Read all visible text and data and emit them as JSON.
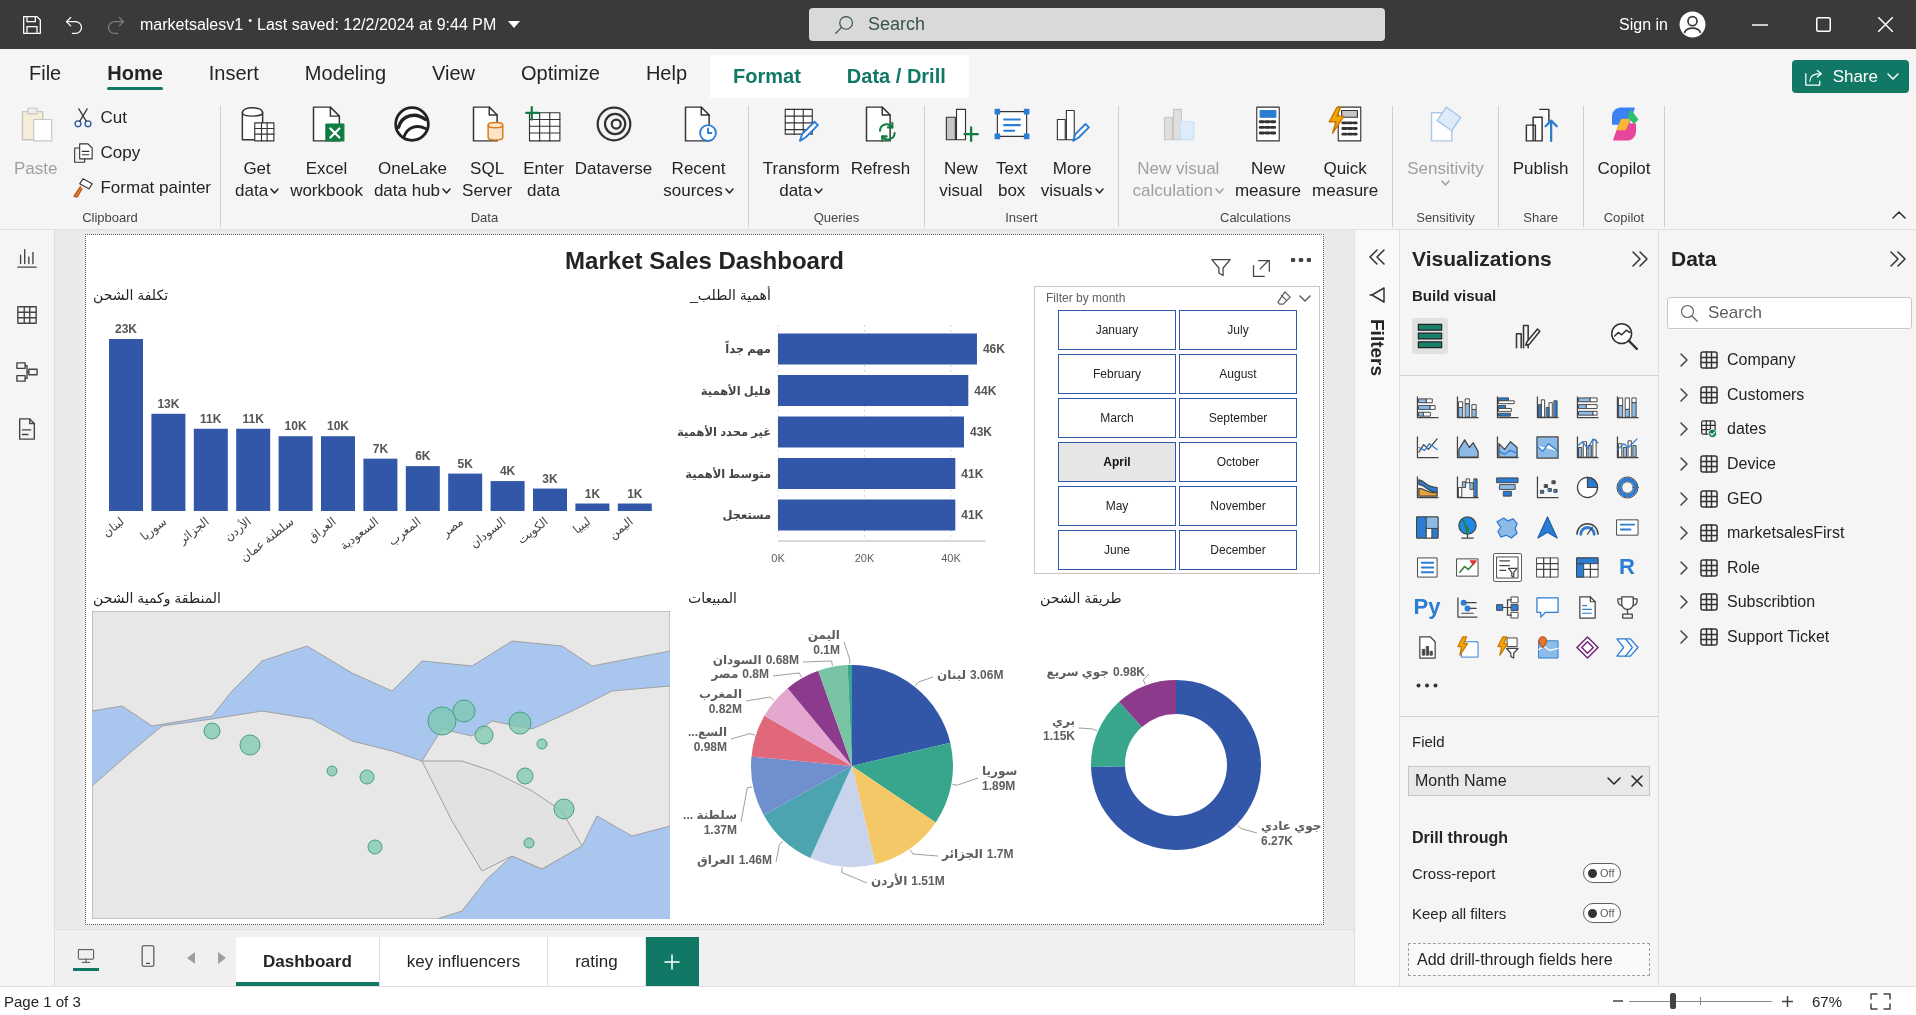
{
  "title_bar": {
    "quick_actions": [
      {
        "disabled": false
      },
      {
        "disabled": false
      },
      {
        "disabled": true
      }
    ],
    "file_name": "marketsalesv1",
    "separator": "•",
    "save_status": "Last saved: 12/2/2024 at 9:44 PM",
    "search": {
      "placeholder": "Search"
    },
    "sign_in": "Sign in"
  },
  "menu_tabs": [
    {
      "label": "File",
      "selected": false,
      "contextual": false
    },
    {
      "label": "Home",
      "selected": true,
      "contextual": false
    },
    {
      "label": "Insert",
      "selected": false,
      "contextual": false
    },
    {
      "label": "Modeling",
      "selected": false,
      "contextual": false
    },
    {
      "label": "View",
      "selected": false,
      "contextual": false
    },
    {
      "label": "Optimize",
      "selected": false,
      "contextual": false
    },
    {
      "label": "Help",
      "selected": false,
      "contextual": false
    },
    {
      "label": "Format",
      "selected": false,
      "contextual": true
    },
    {
      "label": "Data / Drill",
      "selected": false,
      "contextual": true
    }
  ],
  "share_button": {
    "label": "Share"
  },
  "ribbon": {
    "groups": [
      {
        "label": "Clipboard",
        "buttons": [
          {
            "kind": "large",
            "label_lines": [
              "Paste"
            ],
            "dropdown": false,
            "disabled": true
          },
          {
            "kind": "small",
            "label_lines": [
              "Cut"
            ],
            "dropdown": false,
            "disabled": false
          },
          {
            "kind": "small",
            "label_lines": [
              "Copy"
            ],
            "dropdown": false,
            "disabled": false
          },
          {
            "kind": "small",
            "label_lines": [
              "Format painter"
            ],
            "dropdown": false,
            "disabled": false
          }
        ]
      },
      {
        "label": "Data",
        "buttons": [
          {
            "kind": "large",
            "label_lines": [
              "Get",
              "data"
            ],
            "dropdown": true,
            "disabled": false
          },
          {
            "kind": "large",
            "label_lines": [
              "Excel",
              "workbook"
            ],
            "dropdown": false,
            "disabled": false
          },
          {
            "kind": "large",
            "label_lines": [
              "OneLake",
              "data hub"
            ],
            "dropdown": true,
            "disabled": false
          },
          {
            "kind": "large",
            "label_lines": [
              "SQL",
              "Server"
            ],
            "dropdown": false,
            "disabled": false
          },
          {
            "kind": "large",
            "label_lines": [
              "Enter",
              "data"
            ],
            "dropdown": false,
            "disabled": false
          },
          {
            "kind": "large",
            "label_lines": [
              "Dataverse"
            ],
            "dropdown": false,
            "disabled": false
          },
          {
            "kind": "large",
            "label_lines": [
              "Recent",
              "sources"
            ],
            "dropdown": true,
            "disabled": false
          }
        ]
      },
      {
        "label": "Queries",
        "buttons": [
          {
            "kind": "large",
            "label_lines": [
              "Transform",
              "data"
            ],
            "dropdown": true,
            "disabled": false
          },
          {
            "kind": "large",
            "label_lines": [
              "Refresh"
            ],
            "dropdown": false,
            "disabled": false
          }
        ]
      },
      {
        "label": "Insert",
        "buttons": [
          {
            "kind": "large",
            "label_lines": [
              "New",
              "visual"
            ],
            "dropdown": false,
            "disabled": false
          },
          {
            "kind": "large",
            "label_lines": [
              "Text",
              "box"
            ],
            "dropdown": false,
            "disabled": false
          },
          {
            "kind": "large",
            "label_lines": [
              "More",
              "visuals"
            ],
            "dropdown": true,
            "disabled": false
          }
        ]
      },
      {
        "label": "Calculations",
        "buttons": [
          {
            "kind": "large",
            "label_lines": [
              "New visual",
              "calculation"
            ],
            "dropdown": true,
            "disabled": true
          },
          {
            "kind": "large",
            "label_lines": [
              "New",
              "measure"
            ],
            "dropdown": false,
            "disabled": false
          },
          {
            "kind": "large",
            "label_lines": [
              "Quick",
              "measure"
            ],
            "dropdown": false,
            "disabled": false
          }
        ]
      },
      {
        "label": "Sensitivity",
        "buttons": [
          {
            "kind": "large",
            "label_lines": [
              "Sensitivity"
            ],
            "dropdown": true,
            "disabled": true
          }
        ]
      },
      {
        "label": "Share",
        "buttons": [
          {
            "kind": "large",
            "label_lines": [
              "Publish"
            ],
            "dropdown": false,
            "disabled": false
          }
        ]
      },
      {
        "label": "Copilot",
        "buttons": [
          {
            "kind": "large",
            "label_lines": [
              "Copilot"
            ],
            "dropdown": false,
            "disabled": false
          }
        ]
      }
    ]
  },
  "report": {
    "title": "Market Sales Dashboard",
    "shipping_cost_chart": {
      "chart_data": {
        "type": "bar",
        "title": "تكلفة الشحن",
        "categories": [
          "لبنان",
          "سوريا",
          "الجزائر",
          "الأردن",
          "سلطنة عمان",
          "العراق",
          "السعودية",
          "المغرب",
          "مصر",
          "السودان",
          "الكويت",
          "ليبيا",
          "اليمن"
        ],
        "values": [
          23000,
          13000,
          11000,
          11000,
          10000,
          10000,
          7000,
          6000,
          5000,
          4000,
          3000,
          1000,
          1000
        ],
        "value_labels": [
          "23K",
          "13K",
          "11K",
          "11K",
          "10K",
          "10K",
          "7K",
          "6K",
          "5K",
          "4K",
          "3K",
          "1K",
          "1K"
        ]
      }
    },
    "priority_chart": {
      "chart_data": {
        "type": "bar",
        "orientation": "horizontal",
        "title": "أهمية الطلب_",
        "categories": [
          "مهم جداً",
          "قليل الأهمية",
          "غير محدد الأهمية",
          "متوسط الأهمية",
          "مستعجل"
        ],
        "values": [
          46000,
          44000,
          43000,
          41000,
          41000
        ],
        "value_labels": [
          "46K",
          "44K",
          "43K",
          "41K",
          "41K"
        ],
        "xlim": [
          0,
          48000
        ],
        "xticks": [
          {
            "value": 0,
            "label": "0K"
          },
          {
            "value": 20000,
            "label": "20K"
          },
          {
            "value": 40000,
            "label": "40K"
          }
        ]
      }
    },
    "month_slicer": {
      "title": "Filter by month",
      "items": [
        {
          "label": "January",
          "selected": false
        },
        {
          "label": "February",
          "selected": false
        },
        {
          "label": "March",
          "selected": false
        },
        {
          "label": "April",
          "selected": true
        },
        {
          "label": "May",
          "selected": false
        },
        {
          "label": "June",
          "selected": false
        },
        {
          "label": "July",
          "selected": false
        },
        {
          "label": "August",
          "selected": false
        },
        {
          "label": "September",
          "selected": false
        },
        {
          "label": "October",
          "selected": false
        },
        {
          "label": "November",
          "selected": false
        },
        {
          "label": "December",
          "selected": false
        }
      ]
    },
    "map": {
      "title": "المنطقة وكمية الشحن"
    },
    "sales_chart": {
      "chart_data": {
        "type": "pie",
        "title": "المبيعات",
        "categories": [
          "لبنان",
          "سوريا",
          "الجزائر",
          "الأردن",
          "العراق",
          "سلطنة ...",
          "السع...",
          "المغرب",
          "مصر",
          "السودان",
          "اليمن"
        ],
        "values": [
          3.06,
          1.89,
          1.7,
          1.51,
          1.46,
          1.37,
          0.98,
          0.82,
          0.8,
          0.68,
          0.1
        ],
        "value_labels": [
          "3.06M",
          "1.89M",
          "1.7M",
          "1.51M",
          "1.46M",
          "1.37M",
          "0.98M",
          "0.82M",
          "0.8M",
          "0.68M",
          "0.1M"
        ]
      }
    },
    "shipping_method_chart": {
      "chart_data": {
        "type": "donut",
        "title": "طريقة الشحن",
        "categories": [
          "جوي عادي",
          "بري",
          "جوي سريع"
        ],
        "values": [
          6.27,
          1.15,
          0.98
        ],
        "value_labels": [
          "6.27K",
          "1.15K",
          "0.98K"
        ]
      }
    }
  },
  "page_bar": {
    "layout_views": [
      {
        "selected": true
      },
      {
        "selected": false
      }
    ],
    "pages": [
      {
        "label": "Dashboard",
        "selected": true
      },
      {
        "label": "key influencers",
        "selected": false
      },
      {
        "label": "rating",
        "selected": false
      }
    ]
  },
  "filters_pane": {
    "label": "Filters"
  },
  "visualizations": {
    "title": "Visualizations",
    "subtitle": "Build visual",
    "view_tabs": [
      {
        "selected": true
      },
      {
        "selected": false
      },
      {
        "selected": false
      }
    ],
    "gallery": [
      {
        "selected": false
      },
      {
        "selected": false
      },
      {
        "selected": false
      },
      {
        "selected": false
      },
      {
        "selected": false
      },
      {
        "selected": false
      },
      {
        "selected": false
      },
      {
        "selected": false
      },
      {
        "selected": false
      },
      {
        "selected": false
      },
      {
        "selected": false
      },
      {
        "selected": false
      },
      {
        "selected": false
      },
      {
        "selected": false
      },
      {
        "selected": false
      },
      {
        "selected": false
      },
      {
        "selected": false
      },
      {
        "selected": false
      },
      {
        "selected": false
      },
      {
        "selected": false
      },
      {
        "selected": false
      },
      {
        "selected": false
      },
      {
        "selected": false
      },
      {
        "selected": false
      },
      {
        "selected": false
      },
      {
        "selected": false
      },
      {
        "selected": true
      },
      {
        "selected": false
      },
      {
        "selected": false
      },
      {
        "selected": false,
        "glyph": "R"
      },
      {
        "selected": false,
        "glyph": "Py"
      },
      {
        "selected": false
      },
      {
        "selected": false
      },
      {
        "selected": false
      },
      {
        "selected": false
      },
      {
        "selected": false
      },
      {
        "selected": false
      },
      {
        "selected": false
      },
      {
        "selected": false
      },
      {
        "selected": false
      },
      {
        "selected": false
      },
      {
        "selected": false
      }
    ],
    "field_section": {
      "label": "Field",
      "value": "Month Name"
    },
    "drill_through": {
      "title": "Drill through",
      "toggles": [
        {
          "label": "Cross-report",
          "on": false,
          "state_text": "Off"
        },
        {
          "label": "Keep all filters",
          "on": false,
          "state_text": "Off"
        }
      ],
      "drop_zone": "Add drill-through fields here"
    }
  },
  "data_pane": {
    "title": "Data",
    "search": {
      "placeholder": "Search"
    },
    "tables": [
      {
        "name": "Company",
        "expanded": false,
        "in_use": false
      },
      {
        "name": "Customers",
        "expanded": false,
        "in_use": false
      },
      {
        "name": "dates",
        "expanded": false,
        "in_use": true
      },
      {
        "name": "Device",
        "expanded": false,
        "in_use": false
      },
      {
        "name": "GEO",
        "expanded": false,
        "in_use": false
      },
      {
        "name": "marketsalesFirst",
        "expanded": false,
        "in_use": false
      },
      {
        "name": "Role",
        "expanded": false,
        "in_use": false
      },
      {
        "name": "Subscribtion",
        "expanded": false,
        "in_use": false
      },
      {
        "name": "Support Ticket",
        "expanded": false,
        "in_use": false
      }
    ]
  },
  "status_bar": {
    "page_indicator": "Page 1 of 3",
    "zoom": {
      "level": 0.31,
      "reading": "67%"
    }
  }
}
